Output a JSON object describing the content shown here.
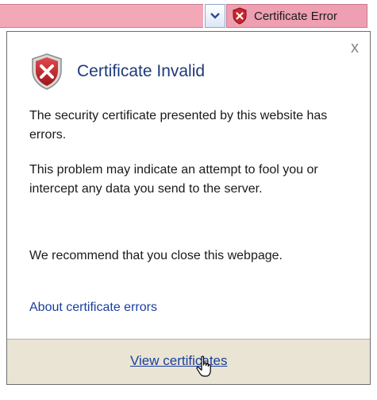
{
  "address_bar": {
    "cert_error_label": "Certificate Error",
    "dropdown_icon": "chevron-down-icon",
    "cert_icon": "shield-error-icon"
  },
  "popup": {
    "close_glyph": "x",
    "title": "Certificate Invalid",
    "paragraphs": [
      "The security certificate presented by this website has errors.",
      "This problem may indicate an attempt to fool you or intercept any data you send to the server.",
      "We recommend that you close this webpage."
    ],
    "about_link": "About certificate errors",
    "view_certificates": "View certificates"
  },
  "colors": {
    "error_pink": "#ee9fb2",
    "link_blue": "#1a3f9c",
    "title_blue": "#1f3a7a",
    "shield_red": "#c8252c",
    "footer_bg": "#e9e4d4"
  }
}
